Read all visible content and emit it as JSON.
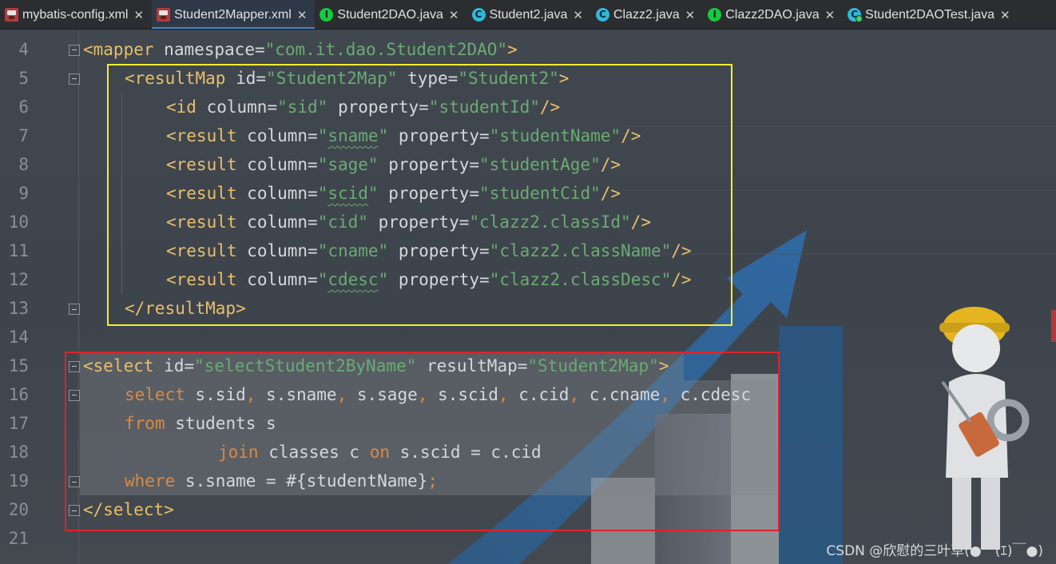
{
  "tabs": [
    {
      "label": "mybatis-config.xml",
      "icon": "xml-file-icon",
      "active": false
    },
    {
      "label": "Student2Mapper.xml",
      "icon": "xml-file-icon",
      "active": true
    },
    {
      "label": "Student2DAO.java",
      "icon": "interface-icon",
      "active": false
    },
    {
      "label": "Student2.java",
      "icon": "class-icon",
      "active": false
    },
    {
      "label": "Clazz2.java",
      "icon": "class-icon",
      "active": false
    },
    {
      "label": "Clazz2DAO.java",
      "icon": "interface-icon",
      "active": false
    },
    {
      "label": "Student2DAOTest.java",
      "icon": "test-class-icon",
      "active": false
    }
  ],
  "close_glyph": "✕",
  "icon_letters": {
    "interface": "I",
    "class": "C"
  },
  "line_numbers": [
    "4",
    "5",
    "6",
    "7",
    "8",
    "9",
    "10",
    "11",
    "12",
    "13",
    "14",
    "15",
    "16",
    "17",
    "18",
    "19",
    "20",
    "21"
  ],
  "code": {
    "l4": {
      "open": "<mapper",
      "a1": "namespace",
      "v1": "\"com.it.dao.Student2DAO\"",
      "end": ">"
    },
    "l5": {
      "open": "<resultMap",
      "a1": "id",
      "v1": "\"Student2Map\"",
      "a2": "type",
      "v2": "\"Student2\"",
      "end": ">"
    },
    "l6": {
      "open": "<id",
      "a1": "column",
      "v1": "\"sid\"",
      "a2": "property",
      "v2": "\"studentId\"",
      "end": "/>"
    },
    "l7": {
      "open": "<result",
      "a1": "column",
      "v1q": "\"",
      "v1w": "sname",
      "v1e": "\"",
      "a2": "property",
      "v2": "\"studentName\"",
      "end": "/>"
    },
    "l8": {
      "open": "<result",
      "a1": "column",
      "v1": "\"sage\"",
      "a2": "property",
      "v2": "\"studentAge\"",
      "end": "/>"
    },
    "l9": {
      "open": "<result",
      "a1": "column",
      "v1q": "\"",
      "v1w": "scid",
      "v1e": "\"",
      "a2": "property",
      "v2": "\"studentCid\"",
      "end": "/>"
    },
    "l10": {
      "open": "<result",
      "a1": "column",
      "v1": "\"cid\"",
      "a2": "property",
      "v2": "\"clazz2.classId\"",
      "end": "/>"
    },
    "l11": {
      "open": "<result",
      "a1": "column",
      "v1": "\"cname\"",
      "a2": "property",
      "v2": "\"clazz2.className\"",
      "end": "/>"
    },
    "l12": {
      "open": "<result",
      "a1": "column",
      "v1q": "\"",
      "v1w": "cdesc",
      "v1e": "\"",
      "a2": "property",
      "v2": "\"clazz2.classDesc\"",
      "end": "/>"
    },
    "l13": {
      "close": "</resultMap>"
    },
    "l15": {
      "open": "<select",
      "a1": "id",
      "v1": "\"selectStudent2ByName\"",
      "a2": "resultMap",
      "v2": "\"Student2Map\"",
      "end": ">"
    },
    "l16": {
      "kw": "select",
      "s1": "s.sid",
      "s2": "s.sname",
      "s3": "s.sage",
      "s4": "s.scid",
      "s5": "c.cid",
      "s6": "c.cname",
      "s7": "c.cdesc",
      "comma": ","
    },
    "l17": {
      "kw": "from",
      "rest": "students s"
    },
    "l18": {
      "kw1": "join",
      "mid": "classes c",
      "kw2": "on",
      "rest": "s.scid = c.cid"
    },
    "l19": {
      "kw": "where",
      "rest": "s.sname = #{studentName}",
      "semi": ";"
    },
    "l20": {
      "close": "</select>"
    }
  },
  "watermark": "CSDN @欣慰的三叶草(●￣(ｴ)￣●)"
}
